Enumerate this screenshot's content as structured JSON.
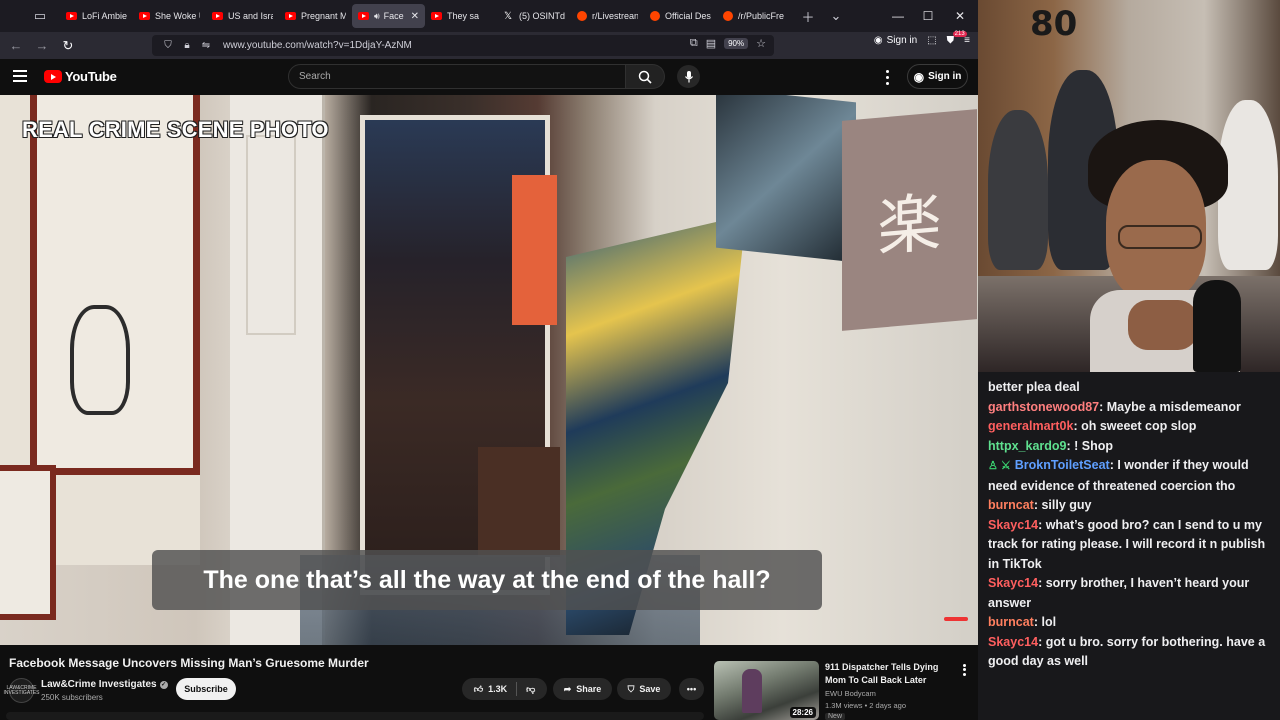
{
  "browser": {
    "tabs": [
      {
        "label": "LoFi Ambie",
        "icon": "youtube-favicon",
        "active": false
      },
      {
        "label": "She Woke U",
        "icon": "youtube-favicon",
        "active": false
      },
      {
        "label": "US and Isra",
        "icon": "youtube-favicon",
        "active": false
      },
      {
        "label": "Pregnant M",
        "icon": "youtube-favicon",
        "active": false
      },
      {
        "label": "Face",
        "icon": "youtube-favicon",
        "active": true
      },
      {
        "label": "They sa",
        "icon": "youtube-favicon",
        "active": false
      },
      {
        "label": "(5) OSINTde",
        "icon": "x-favicon",
        "active": false
      },
      {
        "label": "r/Livestrean",
        "icon": "reddit-favicon",
        "active": false
      },
      {
        "label": "Official Des",
        "icon": "reddit-favicon",
        "active": false
      },
      {
        "label": "/r/PublicFre",
        "icon": "reddit-favicon",
        "active": false
      }
    ],
    "url": "www.youtube.com/watch?v=1DdjaY-AzNM",
    "zoom": "90%",
    "signin_label": "Sign in",
    "notification_count": "213"
  },
  "youtube": {
    "logo_text": "YouTube",
    "search_placeholder": "Search",
    "signin_label": "Sign in"
  },
  "video": {
    "overlay_title": "REAL CRIME SCENE PHOTO",
    "caption": "The one that’s all the way at the end of the hall?",
    "sign_glyph": "楽",
    "title": "Facebook Message Uncovers Missing Man’s Gruesome Murder",
    "channel_name": "Law&Crime Investigates",
    "channel_avatar_text": "LAW&CRIME INVESTIGATES",
    "subscribers": "250K subscribers",
    "subscribe_label": "Subscribe",
    "likes": "1.3K",
    "share_label": "Share",
    "save_label": "Save"
  },
  "recommendation": {
    "title": "911 Dispatcher Tells Dying Mom To Call Back Later",
    "channel": "EWU Bodycam",
    "meta": "1.3M views • 2 days ago",
    "badge": "New",
    "duration": "28:26"
  },
  "webcam": {
    "backdrop_text": "80"
  },
  "chat": {
    "top_fragment": "better plea deal",
    "messages": [
      {
        "user": "garthstonewood87",
        "color": "#ff7f7f",
        "text": ": Maybe a misdemeanor",
        "badge": ""
      },
      {
        "user": "generalmart0k",
        "color": "#ff5f5f",
        "text": ": oh sweeet cop slop",
        "badge": ""
      },
      {
        "user": "httpx_kardo9",
        "color": "#5fe08f",
        "text": ": ! Shop",
        "badge": ""
      },
      {
        "user": "BroknToiletSeat",
        "color": "#5f9fff",
        "text": ": I wonder if they would need evidence of threatened coercion tho",
        "badge": "badges"
      },
      {
        "user": "burncat",
        "color": "#ff7f5f",
        "text": ": silly guy",
        "badge": ""
      },
      {
        "user": "Skayc14",
        "color": "#ff5f5f",
        "text": ": what’s good bro? can I send to u my track for rating please. I will record it n publish in TikTok",
        "badge": ""
      },
      {
        "user": "Skayc14",
        "color": "#ff5f5f",
        "text": ": sorry brother, I haven’t heard your answer",
        "badge": ""
      },
      {
        "user": "burncat",
        "color": "#ff7f5f",
        "text": ": lol",
        "badge": ""
      },
      {
        "user": "Skayc14",
        "color": "#ff5f5f",
        "text": ": got u bro. sorry for bothering. have a good day as well",
        "badge": ""
      }
    ]
  }
}
